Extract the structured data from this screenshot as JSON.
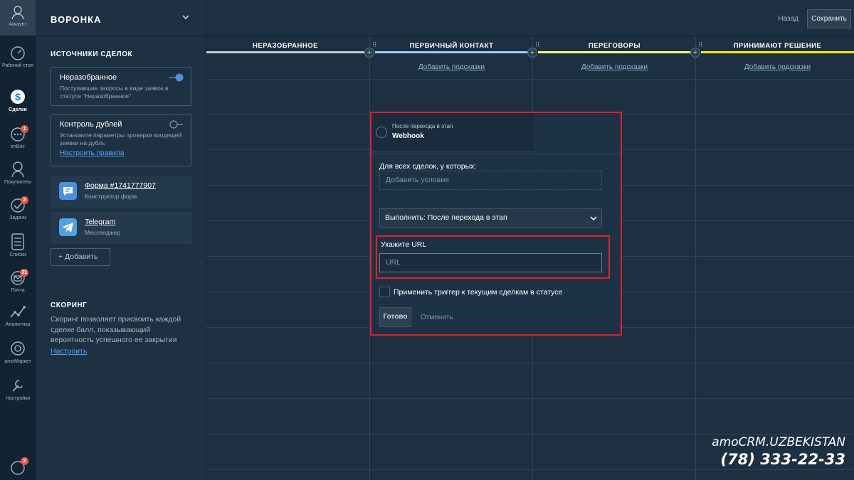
{
  "nav": {
    "account": "Аккаунт",
    "items": [
      {
        "label": "Рабочий стол",
        "badge": ""
      },
      {
        "label": "Сделки",
        "badge": ""
      },
      {
        "label": "imBox",
        "badge": "1"
      },
      {
        "label": "Покупатели",
        "badge": ""
      },
      {
        "label": "Задачи",
        "badge": "2"
      },
      {
        "label": "Списки",
        "badge": ""
      },
      {
        "label": "Почта",
        "badge": "31"
      },
      {
        "label": "Аналитика",
        "badge": ""
      },
      {
        "label": "amoМаркет",
        "badge": ""
      },
      {
        "label": "Настройки",
        "badge": ""
      }
    ],
    "bottom_badge": "2"
  },
  "panel": {
    "title": "ВОРОНКА",
    "sources_title": "ИСТОЧНИКИ СДЕЛОК",
    "unsorted": {
      "title": "Неразобранное",
      "desc": "Поступившие запросы в виде заявок в статусе \"Неразобранное\""
    },
    "dupes": {
      "title": "Контроль дублей",
      "desc": "Установите параметры проверки входящей заявки на дубль",
      "link": "Настроить правила"
    },
    "channels": [
      {
        "name": "Форма #1741777907",
        "sub": "Конструктор форм"
      },
      {
        "name": "Telegram",
        "sub": "Мессенджер"
      }
    ],
    "add_label": "+ Добавить",
    "scoring_title": "СКОРИНГ",
    "scoring_text": "Скоринг позволяет присвоить каждой сделке балл, показывающий вероятность успешного ее закрытия",
    "scoring_link": "Настроить"
  },
  "topbar": {
    "back": "Назад",
    "save": "Сохранить"
  },
  "stages": [
    {
      "name": "НЕРАЗОБРАННОЕ",
      "hint": "",
      "color": "#c4cbd2"
    },
    {
      "name": "ПЕРВИЧНЫЙ КОНТАКТ",
      "hint": "Добавить подсказки",
      "color": "#99ccff"
    },
    {
      "name": "ПЕРЕГОВОРЫ",
      "hint": "Добавить подсказки",
      "color": "#fffd7f"
    },
    {
      "name": "ПРИНИМАЮТ РЕШЕНИЕ",
      "hint": "Добавить подсказки",
      "color": "#fff000"
    }
  ],
  "modal": {
    "head_l1": "После перехода в этап",
    "head_l2": "Webhook",
    "cond_label": "Для всех сделок, у которых:",
    "cond_placeholder": "Добавить условие",
    "exec_value": "Выполнить: После перехода в этап",
    "url_label": "Укажите URL",
    "url_placeholder": "URL",
    "apply_label": "Применить триггер к текущим сделкам в статусе",
    "ok": "Готово",
    "cancel": "Отменить"
  },
  "watermark": {
    "brand": "amoCRM.UZBEKISTAN",
    "phone": "(78) 333-22-33"
  }
}
